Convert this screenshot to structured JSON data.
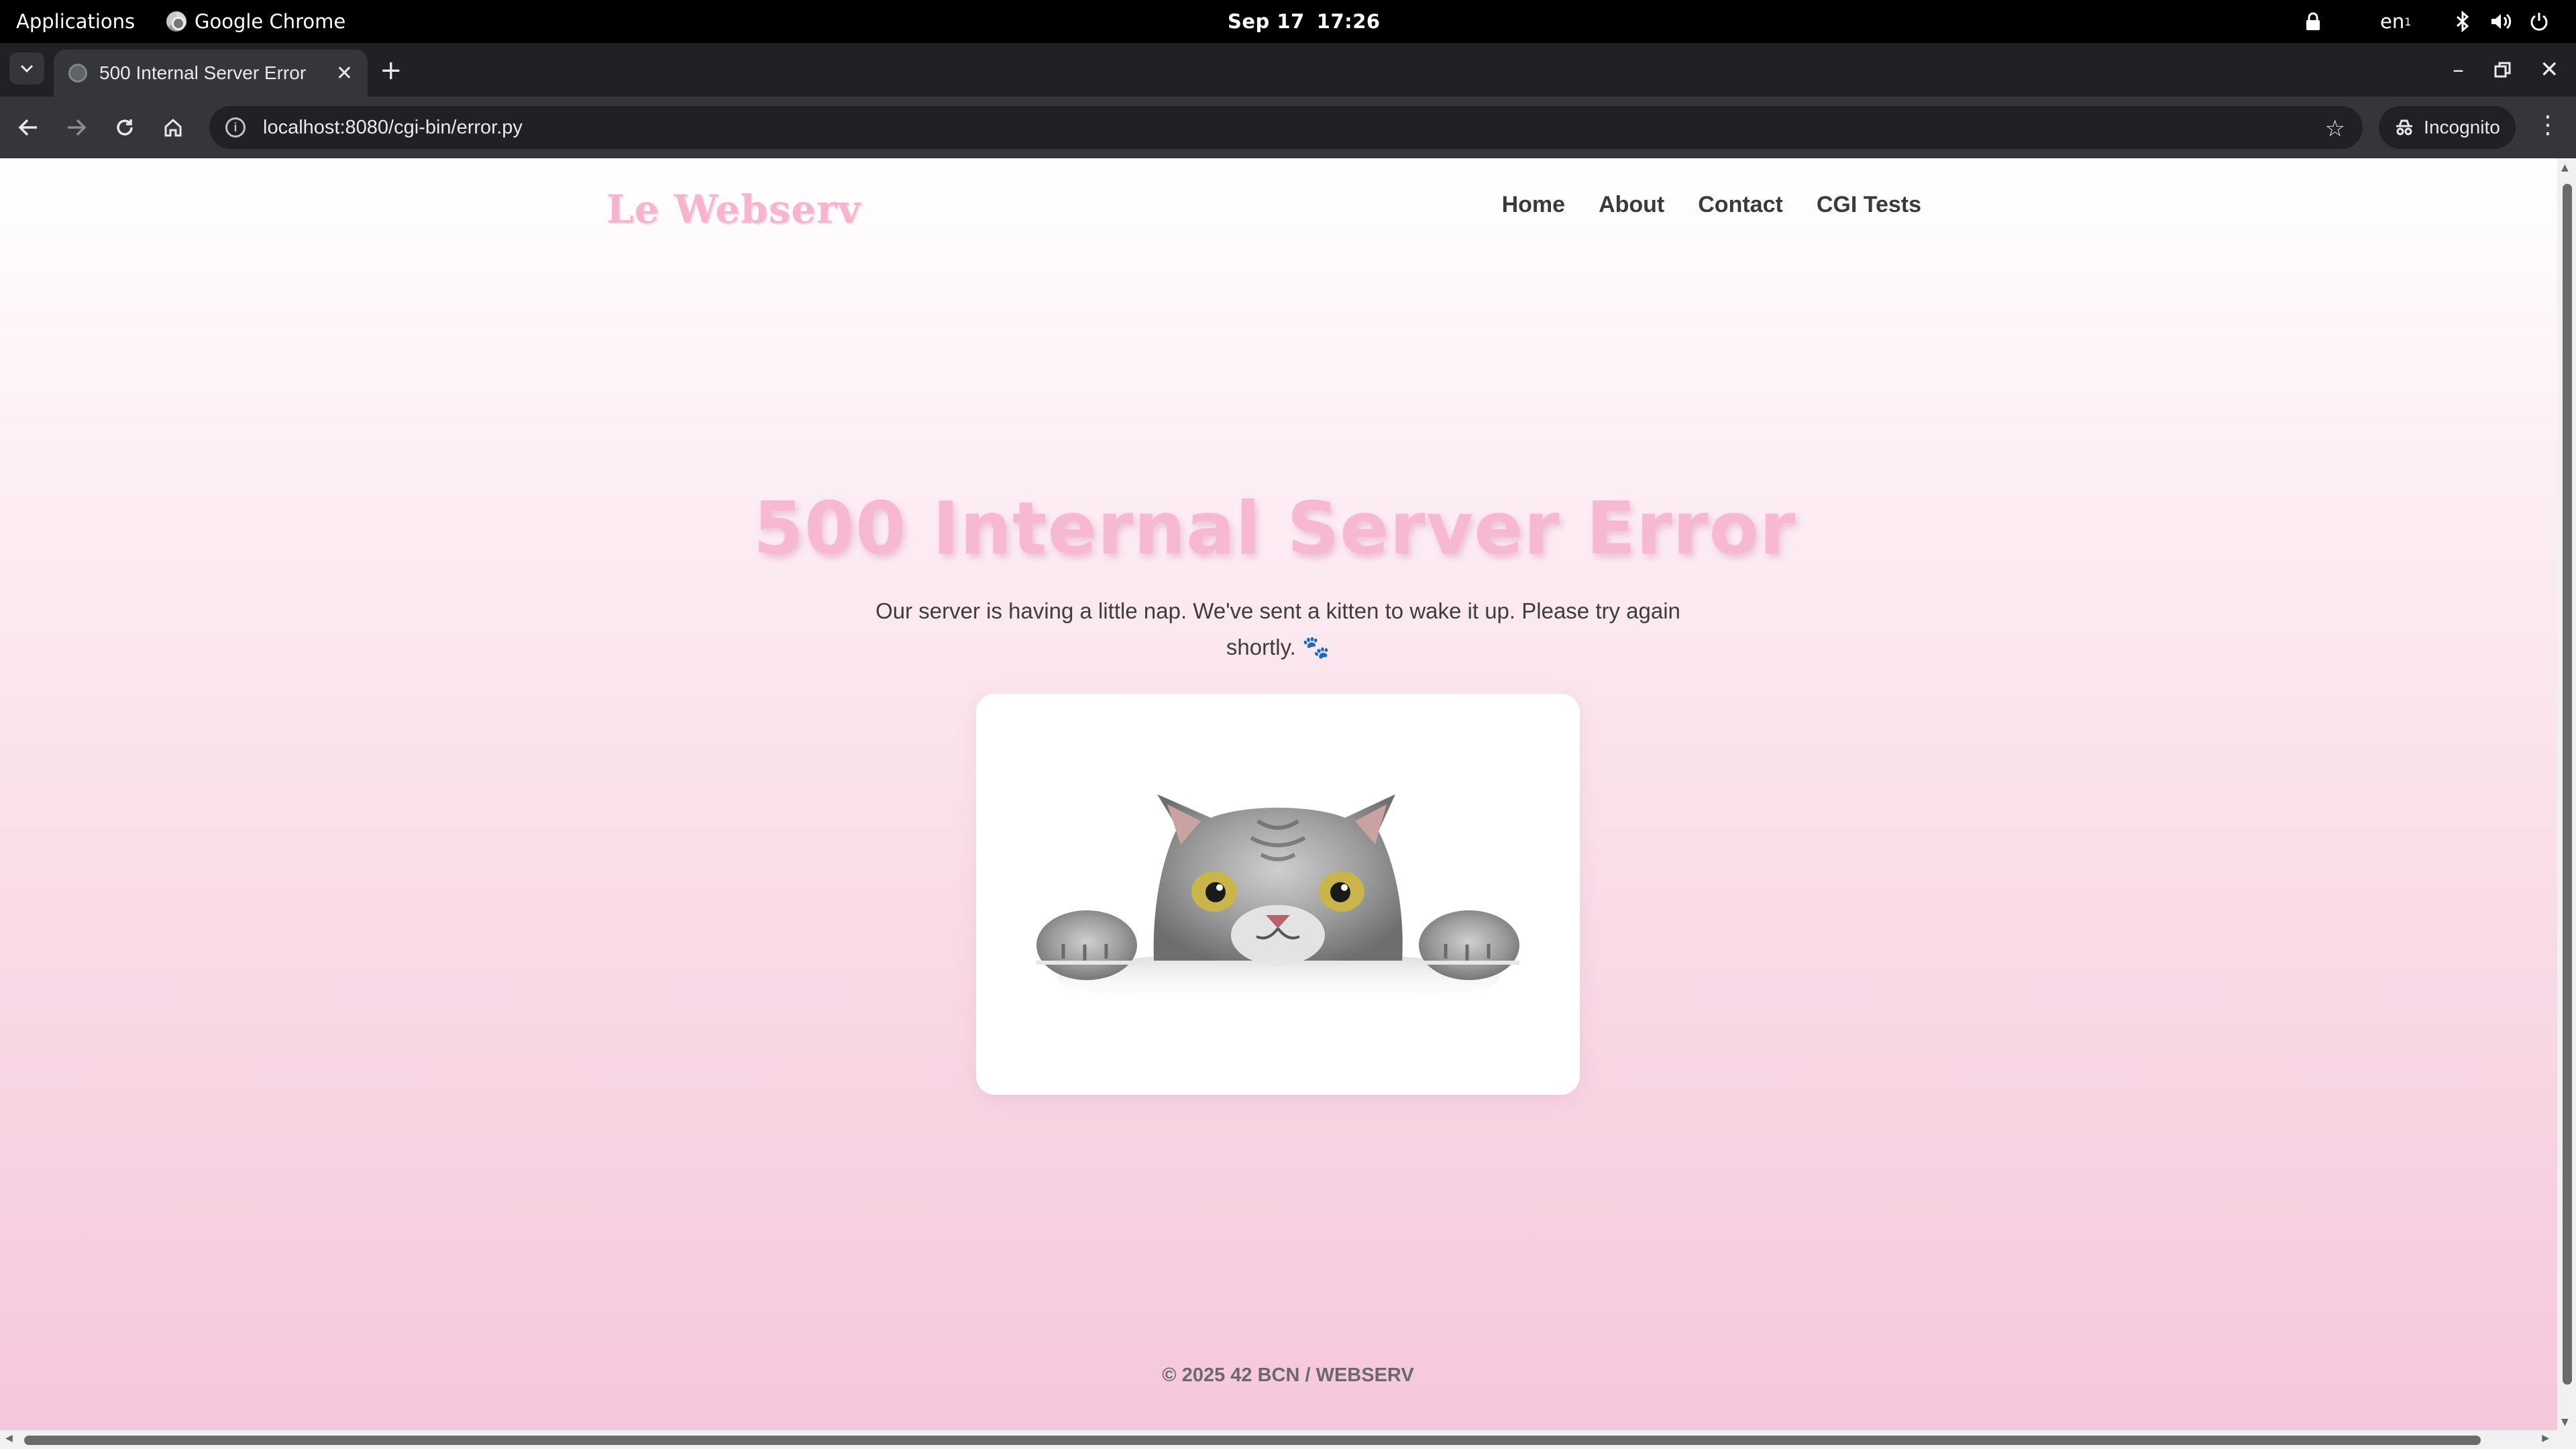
{
  "system_bar": {
    "applications": "Applications",
    "app_name": "Google Chrome",
    "date": "Sep 17",
    "time": "17:26",
    "language": "en",
    "language_suffix": "1"
  },
  "browser": {
    "tab_title": "500 Internal Server Error",
    "url": "localhost:8080/cgi-bin/error.py",
    "incognito_label": "Incognito",
    "icons": [
      "back-icon",
      "forward-icon",
      "reload-icon",
      "home-icon",
      "info-icon",
      "star-icon",
      "incognito-icon",
      "more-icon"
    ]
  },
  "page": {
    "logo": "Le Webserv",
    "nav": [
      "Home",
      "About",
      "Contact",
      "CGI Tests"
    ],
    "title": "500 Internal Server Error",
    "message": "Our server is having a little nap. We've sent a kitten to wake it up. Please try again shortly.",
    "message_emoji": "🐾",
    "footer": "© 2025 42 BCN / WEBSERV",
    "image": "cat peeking over table edge",
    "colors": {
      "accent": "#f7b8d1",
      "background_top": "#ffffff",
      "background_bottom": "#f5c6da"
    }
  }
}
